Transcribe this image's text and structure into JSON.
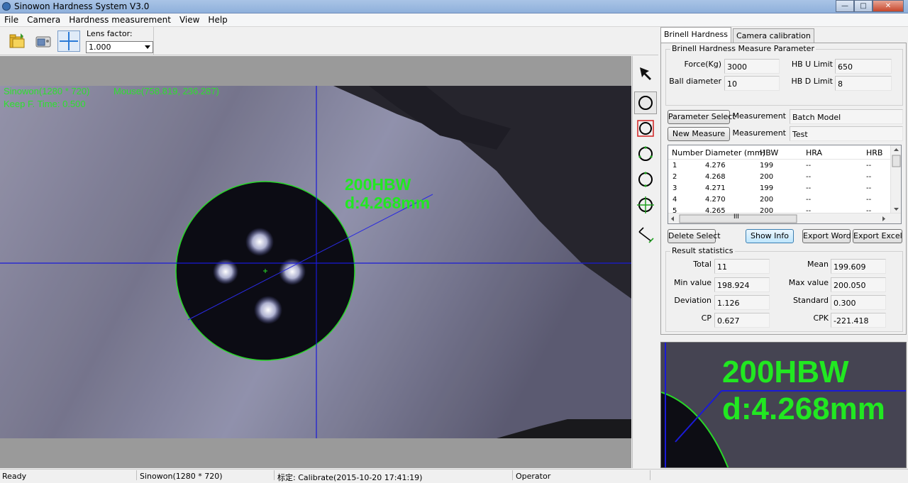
{
  "window": {
    "title": "Sinowon Hardness System V3.0",
    "minimize": "—",
    "maximize": "□",
    "close": "✕"
  },
  "menu": [
    "File",
    "Camera",
    "Hardness measurement",
    "View",
    "Help"
  ],
  "toolbar": {
    "lens_label": "Lens factor:",
    "lens_value": "1.000"
  },
  "overlay": {
    "info1": "Sinowon(1280 * 720)",
    "info2": "Mouse(758.819, 236.287)",
    "info3": "Keep F. Time: 0.500",
    "hbw": "200HBW",
    "diameter": "d:4.268mm"
  },
  "tabs": [
    "Brinell Hardness",
    "Camera calibration"
  ],
  "params": {
    "group_title": "Brinell Hardness Measure Parameter",
    "force_label": "Force(Kg)",
    "force_value": "3000",
    "ball_label": "Ball diameter",
    "ball_value": "10",
    "hbu_label": "HB U Limit",
    "hbu_value": "650",
    "hbd_label": "HB D Limit",
    "hbd_value": "8"
  },
  "actions": {
    "param_select": "Parameter Select",
    "new_measure": "New Measure",
    "measurement_label1": "Measurement",
    "measurement_value1": "Batch Model",
    "measurement_label2": "Measurement",
    "measurement_value2": "Test",
    "delete_select": "Delete Select",
    "show_info": "Show Info",
    "export_word": "Export Word",
    "export_excel": "Export Excel"
  },
  "table": {
    "columns": [
      "Number",
      "Diameter (mm)",
      "HBW",
      "HRA",
      "HRB"
    ],
    "rows": [
      [
        "1",
        "4.276",
        "199",
        "--",
        "--"
      ],
      [
        "2",
        "4.268",
        "200",
        "--",
        "--"
      ],
      [
        "3",
        "4.271",
        "199",
        "--",
        "--"
      ],
      [
        "4",
        "4.270",
        "200",
        "--",
        "--"
      ],
      [
        "5",
        "4.265",
        "200",
        "--",
        "--"
      ]
    ],
    "hscroll_thumb": "III"
  },
  "stats": {
    "group_title": "Result statistics",
    "total_label": "Total",
    "total_value": "11",
    "mean_label": "Mean",
    "mean_value": "199.609",
    "min_label": "Min value",
    "min_value": "198.924",
    "max_label": "Max value",
    "max_value": "200.050",
    "dev_label": "Deviation",
    "dev_value": "1.126",
    "std_label": "Standard",
    "std_value": "0.300",
    "cp_label": "CP",
    "cp_value": "0.627",
    "cpk_label": "CPK",
    "cpk_value": "-221.418"
  },
  "status": {
    "ready": "Ready",
    "resolution": "Sinowon(1280 * 720)",
    "calibrate": "标定: Calibrate(2015-10-20 17:41:19)",
    "operator": "Operator"
  },
  "colors": {
    "overlay_green": "#21e821",
    "crosshair_blue": "#1a1ad8"
  }
}
